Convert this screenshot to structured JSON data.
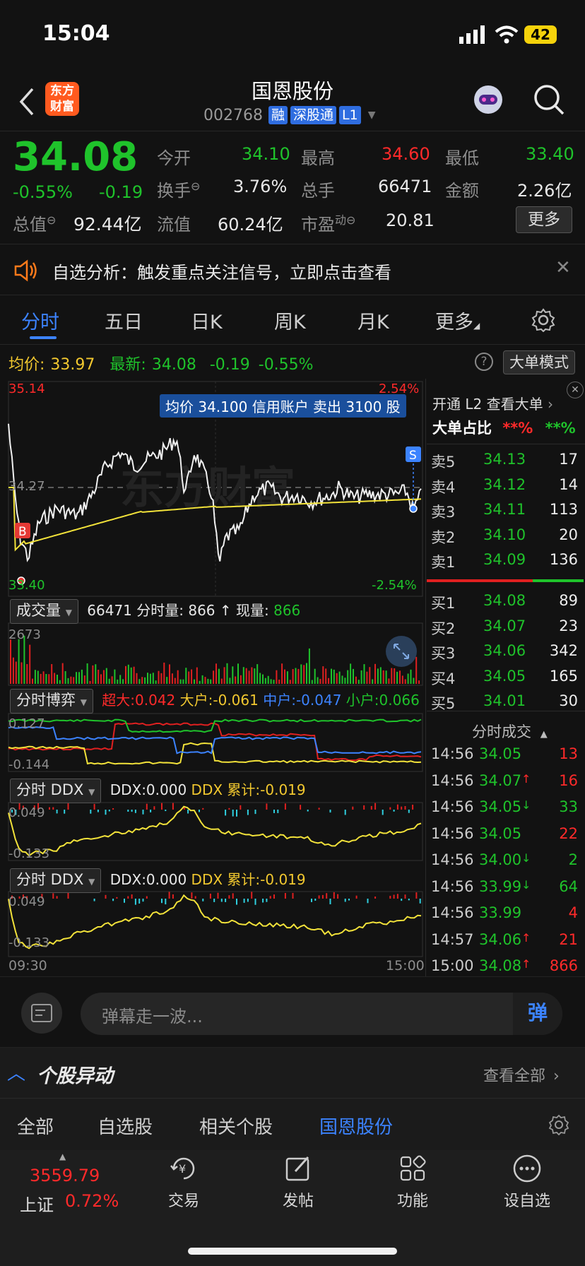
{
  "status_bar": {
    "time": "15:04",
    "battery": "42"
  },
  "header": {
    "title": "国恩股份",
    "code": "002768",
    "tags": [
      "融",
      "深股通",
      "L1"
    ]
  },
  "quote": {
    "price": "34.08",
    "change_pct": "-0.55%",
    "change": "-0.19",
    "open_label": "今开",
    "open": "34.10",
    "high_label": "最高",
    "high": "34.60",
    "low_label": "最低",
    "low": "33.40",
    "turnover_label": "换手",
    "turnover": "3.76%",
    "volume_label": "总手",
    "volume": "66471",
    "amount_label": "金额",
    "amount": "2.26亿",
    "mktcap_label": "总值",
    "mktcap": "92.44亿",
    "float_label": "流值",
    "float": "60.24亿",
    "pe_label": "市盈",
    "pe_sup": "动",
    "pe": "20.81",
    "more": "更多"
  },
  "banner": {
    "text": "自选分析：触发重点关注信号，立即点击查看"
  },
  "chart_tabs": [
    "分时",
    "五日",
    "日K",
    "周K",
    "月K",
    "更多"
  ],
  "info_line": {
    "avg_label": "均价:",
    "avg": "33.97",
    "latest_label": "最新:",
    "latest": "34.08",
    "chg": "-0.19",
    "pct": "-0.55%",
    "mode": "大单模式"
  },
  "intraday": {
    "top_price": "35.14",
    "mid_price": "34.27",
    "bottom_price": "33.40",
    "top_pct": "2.54%",
    "bottom_pct": "-2.54%",
    "tooltip": "均价 34.100 信用账户 卖出 3100 股",
    "watermark": "东方财富",
    "time_start": "09:30",
    "time_end": "15:00"
  },
  "volume_bar": {
    "label": "成交量",
    "total": "66471",
    "detail_label": "分时量: 866 ↑ 现量:",
    "detail_value": "866",
    "max": "2673"
  },
  "game_bar": {
    "label": "分时博弈",
    "super": "超大:0.042",
    "large": "大户:-0.061",
    "mid": "中户:-0.047",
    "small": "小户:0.066",
    "top": "0.127",
    "bottom": "-0.144"
  },
  "ddx1": {
    "label": "分时 DDX",
    "ddx": "DDX:0.000",
    "cum": "DDX 累计:-0.019",
    "top": "0.049",
    "bottom": "-0.133"
  },
  "ddx2": {
    "label": "分时 DDX",
    "ddx": "DDX:0.000",
    "cum": "DDX 累计:-0.019",
    "top": "0.049",
    "bottom": "-0.133"
  },
  "l2": {
    "open": "开通 L2 查看大单",
    "ratio_label": "大单占比",
    "ratio_red": "**%",
    "ratio_green": "**%"
  },
  "order_book": {
    "sell": [
      {
        "label": "卖5",
        "price": "34.13",
        "vol": "17"
      },
      {
        "label": "卖4",
        "price": "34.12",
        "vol": "14"
      },
      {
        "label": "卖3",
        "price": "34.11",
        "vol": "113"
      },
      {
        "label": "卖2",
        "price": "34.10",
        "vol": "20"
      },
      {
        "label": "卖1",
        "price": "34.09",
        "vol": "136"
      }
    ],
    "buy": [
      {
        "label": "买1",
        "price": "34.08",
        "vol": "89"
      },
      {
        "label": "买2",
        "price": "34.07",
        "vol": "23"
      },
      {
        "label": "买3",
        "price": "34.06",
        "vol": "342"
      },
      {
        "label": "买4",
        "price": "34.05",
        "vol": "165"
      },
      {
        "label": "买5",
        "price": "34.01",
        "vol": "30"
      }
    ]
  },
  "trades": {
    "title": "分时成交",
    "rows": [
      {
        "time": "14:56",
        "price": "34.05",
        "arrow": "",
        "vol": "13"
      },
      {
        "time": "14:56",
        "price": "34.07",
        "arrow": "↑",
        "vol": "16"
      },
      {
        "time": "14:56",
        "price": "34.05",
        "arrow": "↓",
        "vol": "33"
      },
      {
        "time": "14:56",
        "price": "34.05",
        "arrow": "",
        "vol": "22"
      },
      {
        "time": "14:56",
        "price": "34.00",
        "arrow": "↓",
        "vol": "2"
      },
      {
        "time": "14:56",
        "price": "33.99",
        "arrow": "↓",
        "vol": "64"
      },
      {
        "time": "14:56",
        "price": "33.99",
        "arrow": "",
        "vol": "4"
      },
      {
        "time": "14:57",
        "price": "34.06",
        "arrow": "↑",
        "vol": "21"
      },
      {
        "time": "15:00",
        "price": "34.08",
        "arrow": "↑",
        "vol": "866"
      }
    ]
  },
  "comment": {
    "placeholder": "弹幕走一波...",
    "send": "弹"
  },
  "movement": {
    "title": "个股异动",
    "view_all": "查看全部"
  },
  "filter_tabs": [
    "全部",
    "自选股",
    "相关个股",
    "国恩股份"
  ],
  "bottom_nav": {
    "index_value": "3559.79",
    "index_name": "上证",
    "index_pct": "0.72%",
    "items": [
      "交易",
      "发帖",
      "功能",
      "设自选"
    ]
  },
  "colors": {
    "up": "#ff2a2a",
    "down": "#1fc32b",
    "accent": "#3c83ff",
    "avg_line": "#f2e23a"
  }
}
